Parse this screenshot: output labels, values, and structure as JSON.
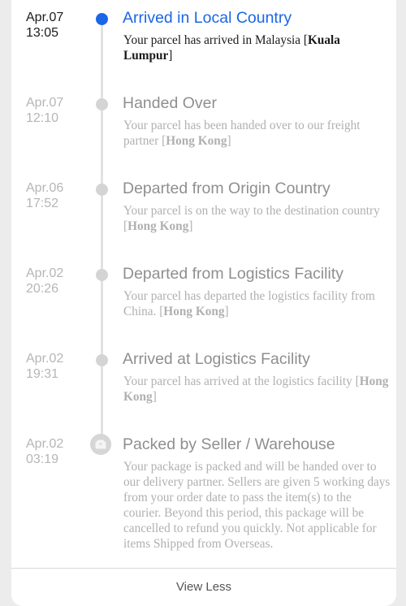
{
  "events": [
    {
      "date": "Apr.07",
      "time": "13:05",
      "title": "Arrived in Local Country",
      "desc_text": "Your parcel has arrived in Malaysia [",
      "desc_loc": "Kuala Lumpur",
      "desc_end": "]"
    },
    {
      "date": "Apr.07",
      "time": "12:10",
      "title": "Handed Over",
      "desc_text": "Your parcel has been handed over to our freight partner [",
      "desc_loc": "Hong Kong",
      "desc_end": "]"
    },
    {
      "date": "Apr.06",
      "time": "17:52",
      "title": "Departed from Origin Country",
      "desc_text": "Your parcel is on the way to the destination country [",
      "desc_loc": "Hong Kong",
      "desc_end": "]"
    },
    {
      "date": "Apr.02",
      "time": "20:26",
      "title": "Departed from Logistics Facility",
      "desc_text": "Your parcel has departed the logistics facility from China. [",
      "desc_loc": "Hong Kong",
      "desc_end": "]"
    },
    {
      "date": "Apr.02",
      "time": "19:31",
      "title": "Arrived at Logistics Facility",
      "desc_text": "Your parcel has arrived at the logistics facility [",
      "desc_loc": "Hong Kong",
      "desc_end": "]"
    },
    {
      "date": "Apr.02",
      "time": "03:19",
      "title": "Packed by Seller / Warehouse",
      "desc_text": "Your package is packed and will be handed over to our delivery partner. Sellers are given 5 working days from your order date to pass the item(s) to the courier. Beyond this period, this package will be cancelled to refund you quickly. Not applicable for items Shipped from Overseas.",
      "icon": "package-icon"
    }
  ],
  "footer": {
    "view_less_label": "View Less"
  },
  "colors": {
    "active_blue": "#1a66e6",
    "inactive_gray": "#8f8f8f",
    "dot_gray": "#d4d4d4"
  }
}
